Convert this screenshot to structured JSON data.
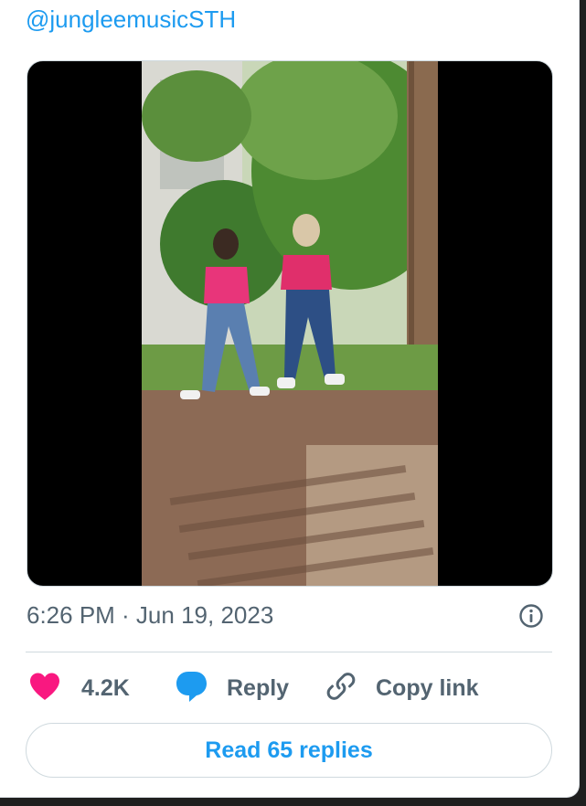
{
  "tweet": {
    "handle": "@jungleemusicSTH",
    "timestamp": "6:26 PM · Jun 19, 2023"
  },
  "actions": {
    "like_count": "4.2K",
    "reply_label": "Reply",
    "copy_link_label": "Copy link"
  },
  "read_replies_label": "Read 65 replies",
  "colors": {
    "accent": "#1d9bf0",
    "like": "#f91880",
    "muted_text": "#536471",
    "border": "#cfd9de"
  },
  "icons": [
    "heart-icon",
    "reply-bubble-icon",
    "link-icon",
    "info-icon"
  ]
}
